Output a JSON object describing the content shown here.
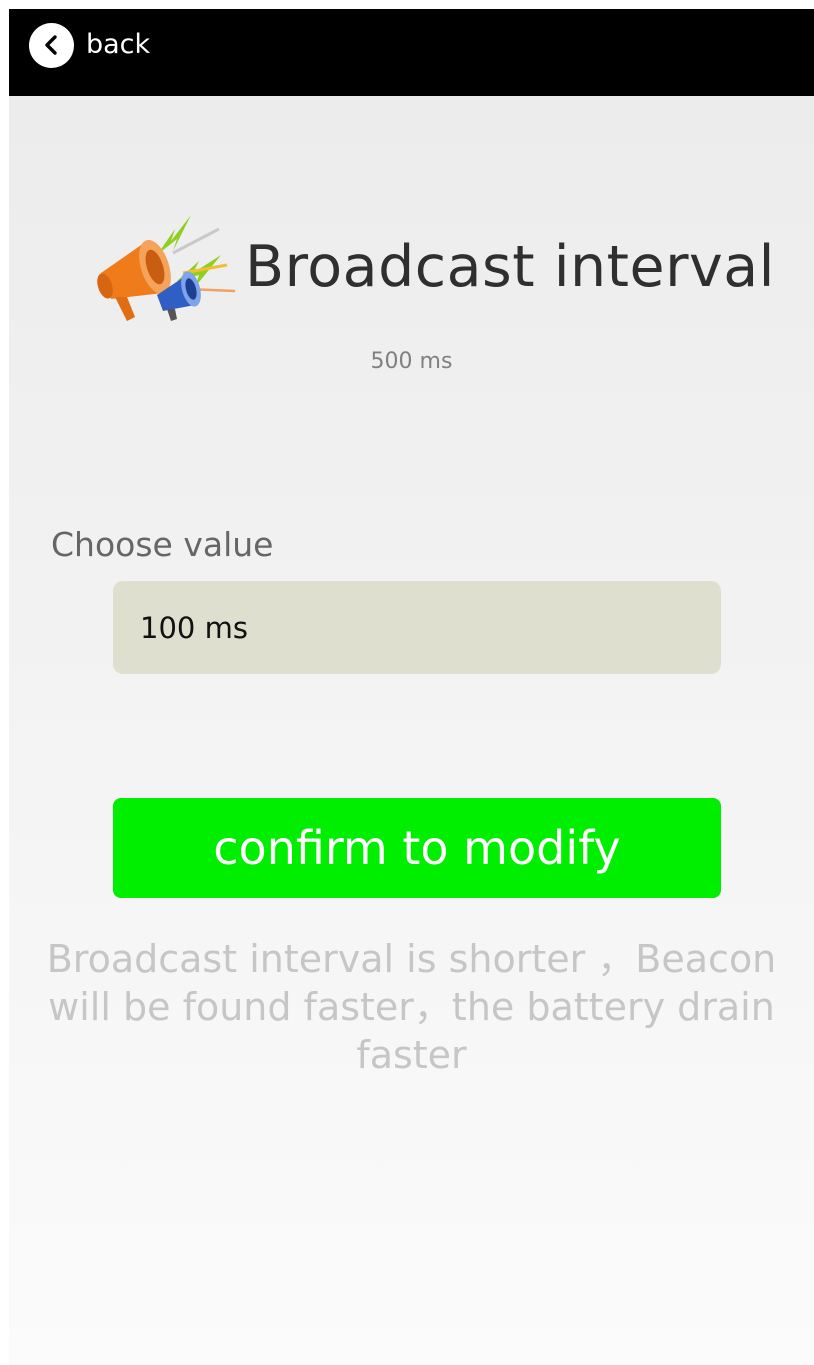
{
  "header": {
    "back_label": "back",
    "back_icon": "chevron-left-icon"
  },
  "main": {
    "title_icon": "megaphone-icon",
    "title": "Broadcast interval",
    "current_value": "500 ms",
    "choose_label": "Choose value",
    "selected_value": "100 ms",
    "confirm_label": "confirm to modify",
    "hint": "Broadcast interval is shorter ，Beacon will be found faster，the battery drain faster"
  },
  "colors": {
    "topbar": "#000000",
    "confirm_button": "#00ee00",
    "select_background": "#dfdfcf"
  }
}
